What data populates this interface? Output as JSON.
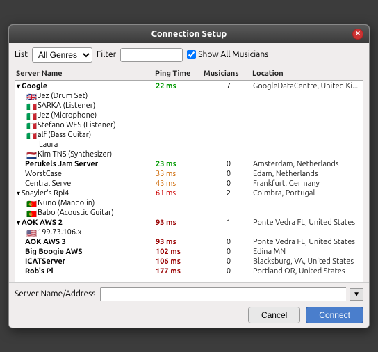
{
  "title": "Connection Setup",
  "toolbar": {
    "list_label": "List",
    "filter_label": "Filter",
    "show_all_label": "Show All Musicians",
    "list_options": [
      "All Genres"
    ],
    "list_selected": "All Genres"
  },
  "columns": {
    "server_name": "Server Name",
    "ping_time": "Ping Time",
    "musicians": "Musicians",
    "location": "Location"
  },
  "servers": [
    {
      "id": "google",
      "name": "Google",
      "ping": "22 ms",
      "ping_class": "green",
      "musicians": "7",
      "location": "GoogleDataCentre, United Ki...",
      "bold": true,
      "expanded": true,
      "children": [
        {
          "flag": "🇬🇧",
          "label": "Jez  (Drum Set)"
        },
        {
          "flag": "🇮🇹",
          "label": "SARKA (Listener)"
        },
        {
          "flag": "🇮🇹",
          "label": "Jez  (Microphone)"
        },
        {
          "flag": "🇮🇹",
          "label": "Stefano WES (Listener)"
        },
        {
          "flag": "🇮🇹",
          "label": "alf (Bass Guitar)"
        },
        {
          "flag": "",
          "label": "Laura"
        },
        {
          "flag": "🇳🇱",
          "label": "Kim   TNS (Synthesizer)"
        }
      ]
    },
    {
      "id": "perukels",
      "name": "Perukels Jam Server",
      "ping": "23 ms",
      "ping_class": "green",
      "musicians": "0",
      "location": "Amsterdam, Netherlands",
      "bold": true
    },
    {
      "id": "worstcase",
      "name": "WorstCase",
      "ping": "33 ms",
      "ping_class": "orange",
      "musicians": "0",
      "location": "Edam, Netherlands",
      "bold": false
    },
    {
      "id": "central",
      "name": "Central Server",
      "ping": "43 ms",
      "ping_class": "orange",
      "musicians": "0",
      "location": "Frankfurt, Germany",
      "bold": false
    },
    {
      "id": "snayler",
      "name": "Snayler's Rpi4",
      "ping": "61 ms",
      "ping_class": "red",
      "musicians": "2",
      "location": "Coimbra, Portugal",
      "bold": false,
      "expanded": true,
      "children": [
        {
          "flag": "🇵🇹",
          "label": "Nuno (Mandolin)"
        },
        {
          "flag": "🇵🇹",
          "label": "Babo (Acoustic Guitar)"
        }
      ]
    },
    {
      "id": "aok2",
      "name": "AOK AWS 2",
      "ping": "93 ms",
      "ping_class": "darkred",
      "musicians": "1",
      "location": "Ponte Vedra FL, United States",
      "bold": true,
      "expanded": true,
      "children": [
        {
          "flag": "🇺🇸",
          "label": "199.73.106.x"
        }
      ]
    },
    {
      "id": "aok3",
      "name": "AOK AWS 3",
      "ping": "93 ms",
      "ping_class": "darkred",
      "musicians": "0",
      "location": "Ponte Vedra FL, United States",
      "bold": true
    },
    {
      "id": "bigboogie",
      "name": "Big Boogie AWS",
      "ping": "102 ms",
      "ping_class": "darkred",
      "musicians": "0",
      "location": "Edina MN",
      "bold": true
    },
    {
      "id": "icat",
      "name": "ICATServer",
      "ping": "106 ms",
      "ping_class": "darkred",
      "musicians": "0",
      "location": "Blacksburg, VA, United States",
      "bold": true
    },
    {
      "id": "robspi",
      "name": "Rob's Pi",
      "ping": "177 ms",
      "ping_class": "darkred",
      "musicians": "0",
      "location": "Portland OR, United States",
      "bold": true
    }
  ],
  "footer": {
    "address_label": "Server Name/Address",
    "address_value": "",
    "cancel_label": "Cancel",
    "connect_label": "Connect"
  }
}
